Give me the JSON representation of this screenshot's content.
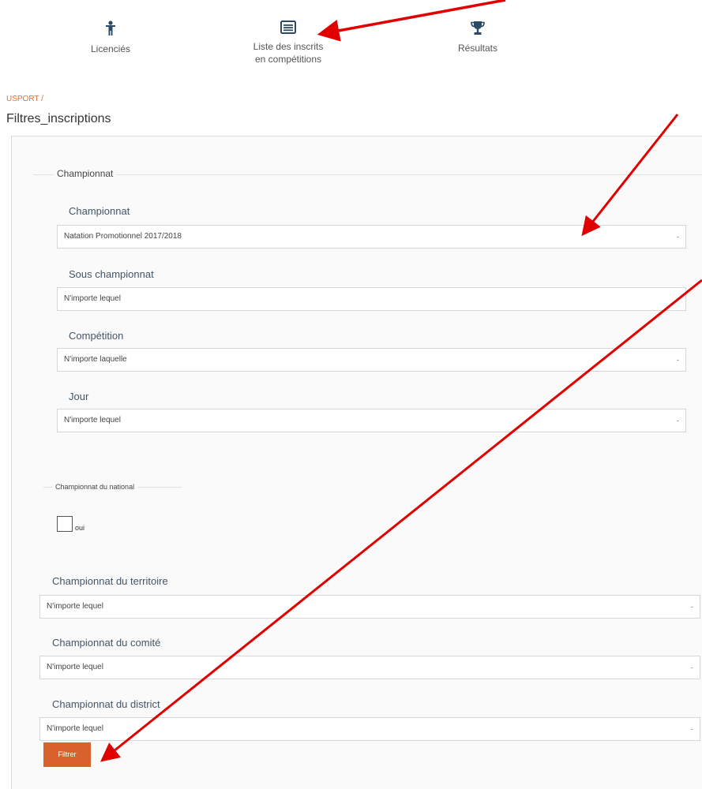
{
  "nav": {
    "items": [
      {
        "id": "licencies",
        "label": "Licenciés",
        "icon": "person-icon"
      },
      {
        "id": "liste",
        "label": "Liste des inscrits en compétitions",
        "icon": "list-icon"
      },
      {
        "id": "resultats",
        "label": "Résultats",
        "icon": "trophy-icon"
      }
    ]
  },
  "breadcrumb": "USPORT /",
  "page_title": "Filtres_inscriptions",
  "championnat_section": {
    "legend": "Championnat",
    "fields": [
      {
        "label": "Championnat",
        "value": "Natation Promotionnel 2017/2018"
      },
      {
        "label": "Sous championnat",
        "value": "N'importe lequel"
      },
      {
        "label": "Compétition",
        "value": "N'importe laquelle"
      },
      {
        "label": "Jour",
        "value": "N'importe lequel"
      }
    ]
  },
  "national_section": {
    "legend": "Championnat du national",
    "checkbox_label": "oui",
    "checked": false
  },
  "other_fields": [
    {
      "label": "Championnat du territoire",
      "value": "N'importe lequel"
    },
    {
      "label": "Championnat du comité",
      "value": "N'importe lequel"
    },
    {
      "label": "Championnat du district",
      "value": "N'importe lequel"
    }
  ],
  "filter_button": "Filtrer",
  "caret_glyph": "-",
  "colors": {
    "accent": "#d9622c",
    "annotation_arrow": "#e00000"
  }
}
